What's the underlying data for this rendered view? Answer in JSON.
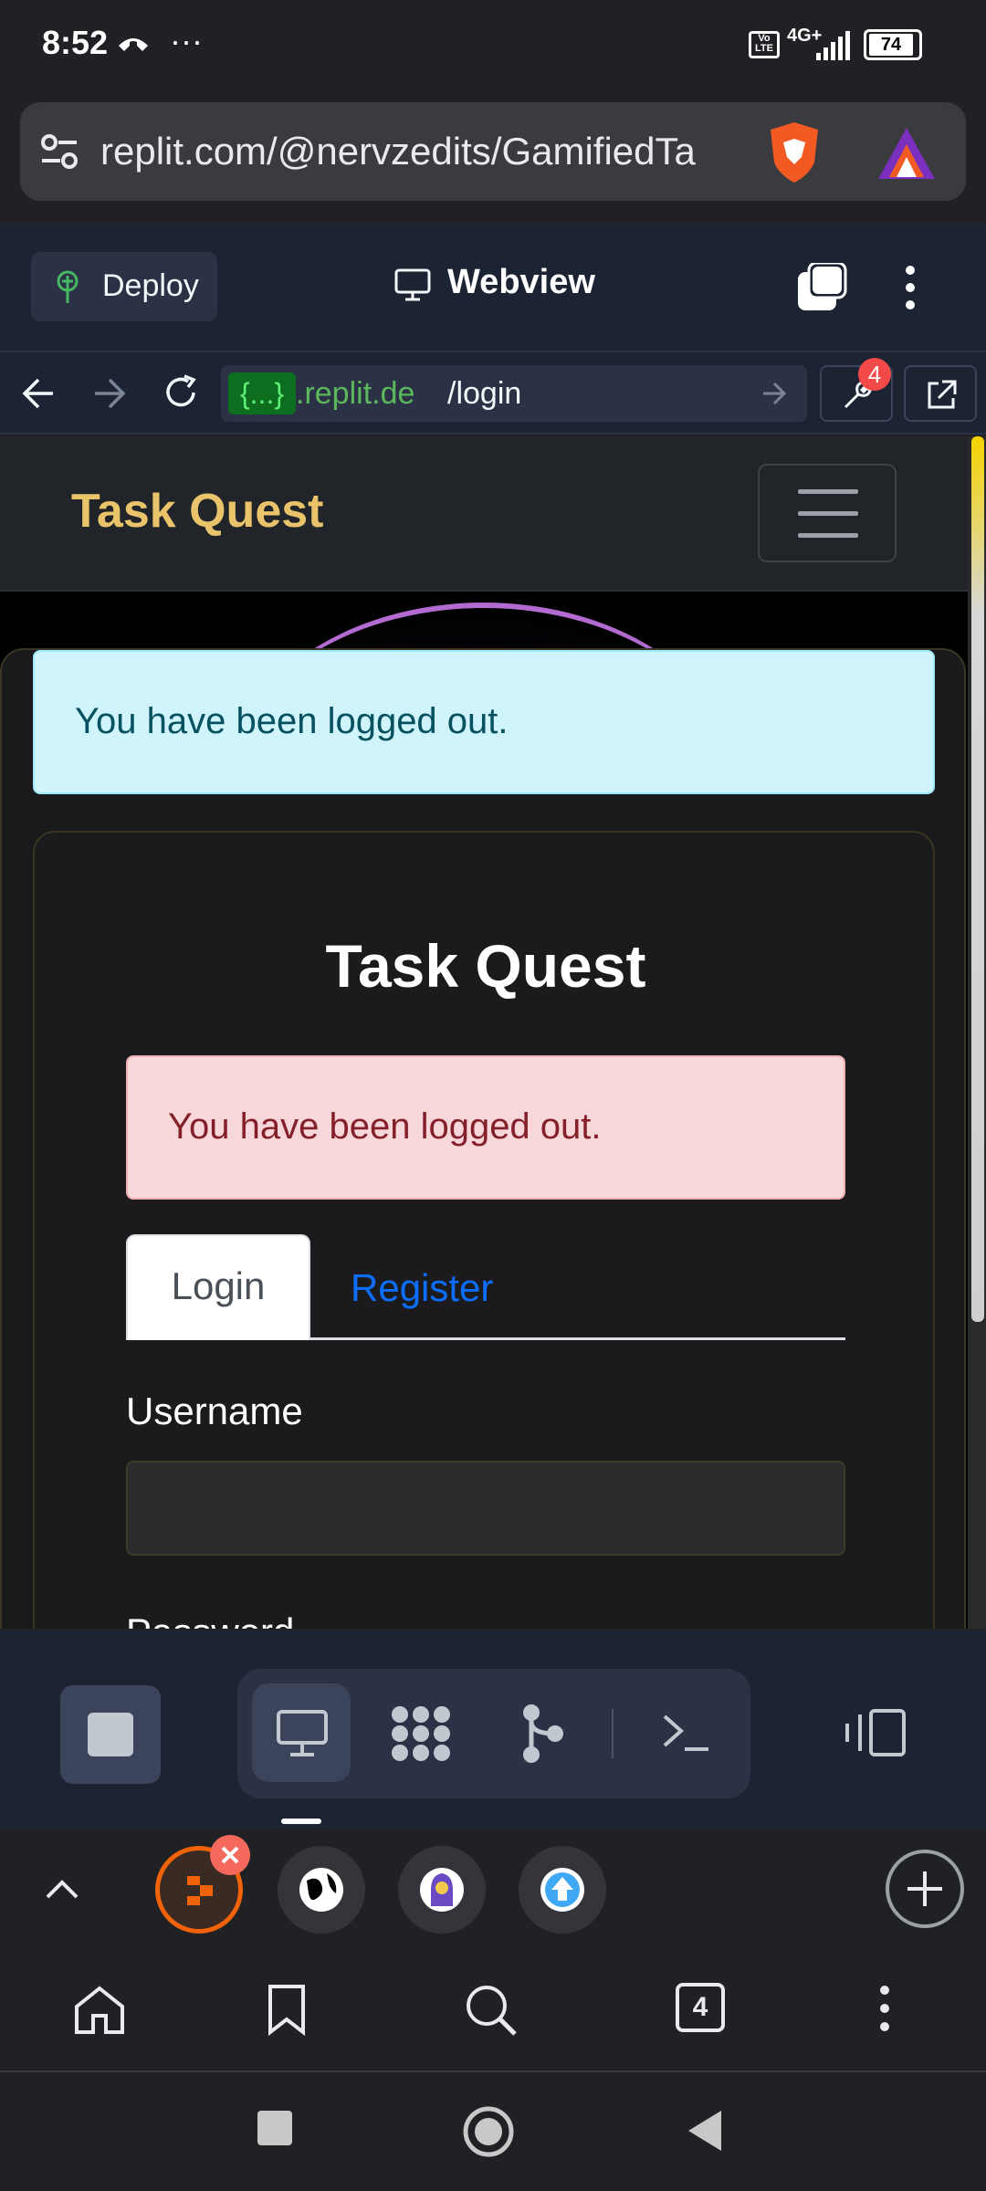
{
  "status_bar": {
    "time": "8:52",
    "dots": "···",
    "network": "4G+",
    "volte": "Vo LTE",
    "battery": "74"
  },
  "browser": {
    "url": "replit.com/@nervzedits/GamifiedTa",
    "tab_count": "4"
  },
  "replit": {
    "deploy_label": "Deploy",
    "pane_title": "Webview",
    "devtools_badge": "4",
    "address": {
      "pill": "{...}",
      "domain": ".replit.de",
      "path": "/login"
    }
  },
  "app": {
    "brand": "Task Quest",
    "info_alert": "You have been logged out.",
    "card_title": "Task Quest",
    "danger_alert": "You have been logged out.",
    "tabs": [
      {
        "label": "Login",
        "active": true
      },
      {
        "label": "Register",
        "active": false
      }
    ],
    "username_label": "Username",
    "username_value": "",
    "password_label": "Password"
  },
  "colors": {
    "brand": "#e9c46a",
    "link": "#0d6efd",
    "info_bg": "#cff4fc",
    "danger_bg": "#f8d7da",
    "replit_bg": "#1c2333"
  },
  "icons": {
    "statusbar": [
      "wifi-call-icon",
      "signal-icon",
      "battery-icon"
    ],
    "urlbar": [
      "site-settings-icon",
      "brave-shield-icon",
      "brave-rewards-icon"
    ],
    "webview_nav": [
      "back-icon",
      "forward-icon",
      "reload-icon",
      "go-icon",
      "devtools-icon",
      "open-external-icon"
    ],
    "toolbar": [
      "stop-icon",
      "webview-icon",
      "apps-icon",
      "git-icon",
      "shell-icon",
      "layout-icon"
    ]
  }
}
